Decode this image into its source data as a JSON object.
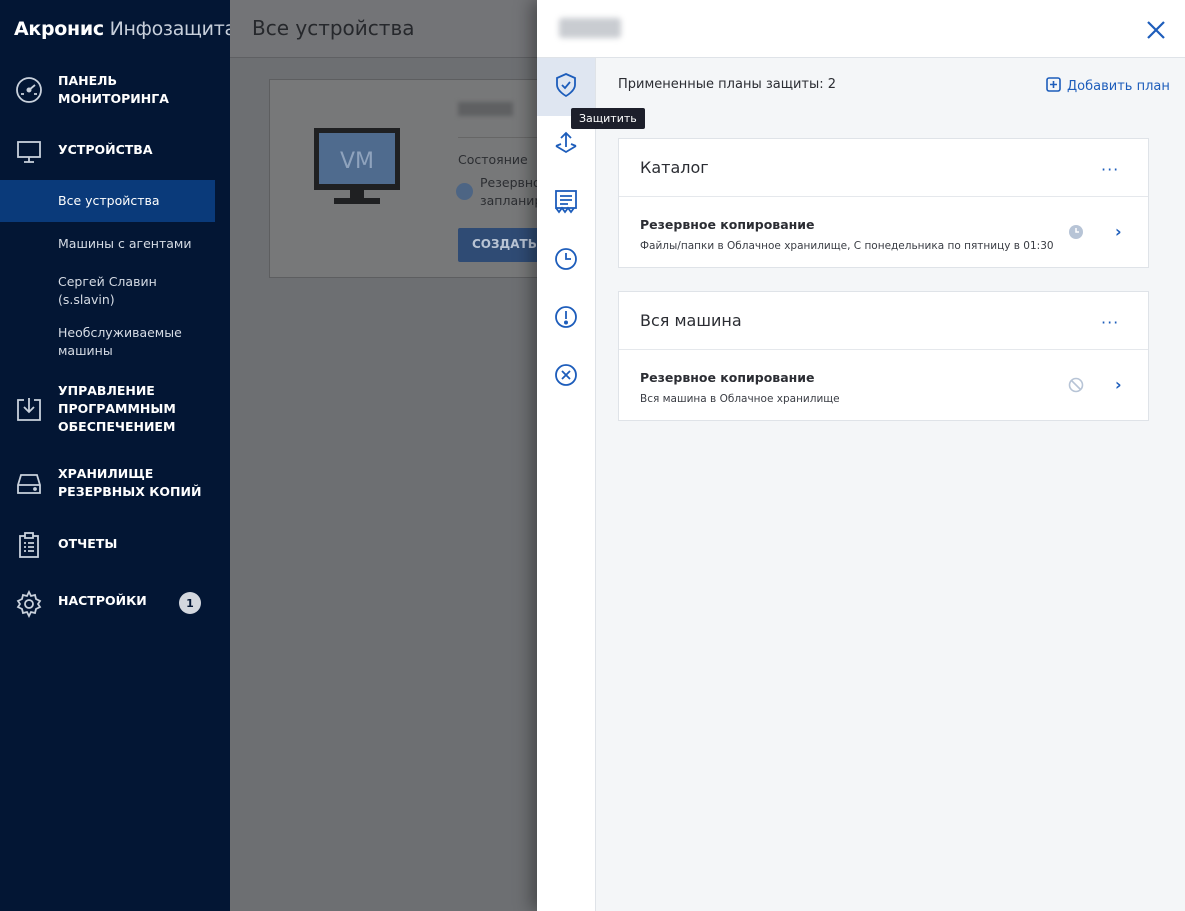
{
  "brand": {
    "part1": "Акронис",
    "part2": "Инфозащита"
  },
  "sidebar": {
    "items": [
      {
        "label": "ПАНЕЛЬ\nМОНИТОРИНГА",
        "icon": "gauge-icon"
      },
      {
        "label": "УСТРОЙСТВА",
        "icon": "monitor-icon"
      },
      {
        "label": "УПРАВЛЕНИЕ\nПРОГРАММНЫМ\nОБЕСПЕЧЕНИЕМ",
        "icon": "download-box-icon"
      },
      {
        "label": "ХРАНИЛИЩЕ\nРЕЗЕРВНЫХ КОПИЙ",
        "icon": "drive-icon"
      },
      {
        "label": "ОТЧЕТЫ",
        "icon": "clipboard-icon"
      },
      {
        "label": "НАСТРОЙКИ",
        "icon": "gear-icon",
        "badge": "1"
      }
    ],
    "sub_items": [
      {
        "label": "Все устройства",
        "active": true
      },
      {
        "label": "Машины с агентами"
      },
      {
        "label": "Сергей Славин\n(s.slavin)"
      },
      {
        "label": "Необслуживаемые\nмашины"
      }
    ]
  },
  "main": {
    "title": "Все устройства",
    "card": {
      "vm_label": "VM",
      "state_label": "Состояние",
      "status_line1": "Резервно",
      "status_line2": "запланир",
      "button_label": "СОЗДАТЬ Р"
    }
  },
  "panel": {
    "tooltip": "Защитить",
    "applied_label": "Примененные планы защиты: 2",
    "add_plan_label": "Добавить план",
    "rail_icons": [
      "shield-check-icon",
      "recovery-icon",
      "activities-icon",
      "history-clock-icon",
      "alert-icon",
      "cancel-circle-icon"
    ],
    "plans": [
      {
        "name": "Каталог",
        "row_title": "Резервное копирование",
        "row_desc": "Файлы/папки в Облачное хранилище, С понедельника по пятницу в 01:30",
        "status_icon": "clock-status-icon"
      },
      {
        "name": "Вся машина",
        "row_title": "Резервное копирование",
        "row_desc": "Вся машина в Облачное хранилище",
        "status_icon": "disabled-status-icon"
      }
    ],
    "more_label": "···",
    "chevron_label": "›"
  },
  "colors": {
    "sidebar_bg": "#031634",
    "accent": "#1d5dbb",
    "active_nav": "#0a3a7a"
  }
}
